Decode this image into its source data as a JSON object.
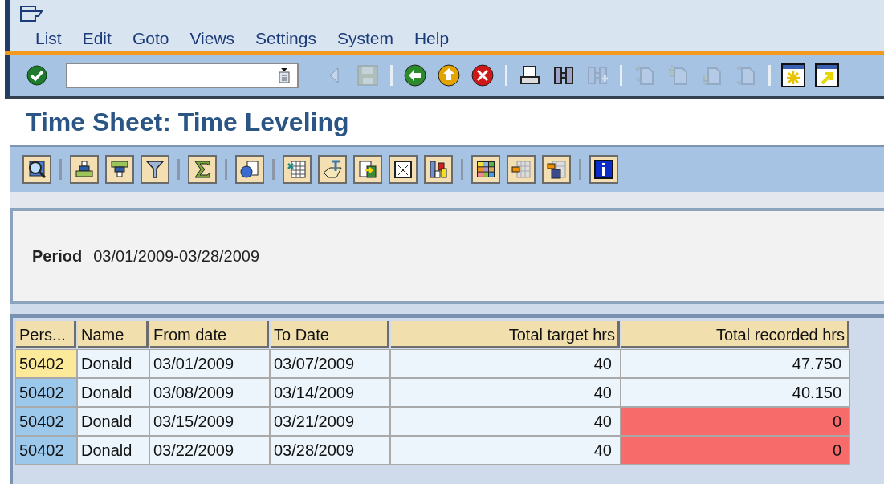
{
  "menu": [
    {
      "label": "List"
    },
    {
      "label": "Edit"
    },
    {
      "label": "Goto"
    },
    {
      "label": "Views"
    },
    {
      "label": "Settings"
    },
    {
      "label": "System"
    },
    {
      "label": "Help"
    }
  ],
  "system_toolbar": [
    {
      "disabled": false
    },
    {
      "disabled": true
    },
    {
      "disabled": true
    },
    {
      "disabled": false
    },
    {
      "disabled": false
    },
    {
      "disabled": false
    },
    {
      "disabled": false
    },
    {
      "disabled": false
    },
    {
      "disabled": true
    },
    {
      "disabled": true
    },
    {
      "disabled": true
    },
    {
      "disabled": true
    },
    {
      "disabled": true
    },
    {
      "disabled": false
    },
    {
      "disabled": false
    }
  ],
  "title": "Time Sheet: Time Leveling",
  "header": {
    "label": "Period",
    "value": "03/01/2009-03/28/2009"
  },
  "table": {
    "columns": [
      {
        "label": "Pers...",
        "kind": "text"
      },
      {
        "label": "Name",
        "kind": "text"
      },
      {
        "label": "From date",
        "kind": "text"
      },
      {
        "label": "To Date",
        "kind": "text"
      },
      {
        "label": "Total target hrs",
        "kind": "number"
      },
      {
        "label": "Total recorded hrs",
        "kind": "number"
      }
    ],
    "rows": [
      {
        "selected": true,
        "cells": [
          "50402",
          "Donald",
          "03/01/2009",
          "03/07/2009",
          "40",
          "47.750"
        ],
        "alert": false
      },
      {
        "selected": false,
        "cells": [
          "50402",
          "Donald",
          "03/08/2009",
          "03/14/2009",
          "40",
          "40.150"
        ],
        "alert": false
      },
      {
        "selected": false,
        "cells": [
          "50402",
          "Donald",
          "03/15/2009",
          "03/21/2009",
          "40",
          "0"
        ],
        "alert": true
      },
      {
        "selected": false,
        "cells": [
          "50402",
          "Donald",
          "03/22/2009",
          "03/28/2009",
          "40",
          "0"
        ],
        "alert": true
      }
    ]
  }
}
